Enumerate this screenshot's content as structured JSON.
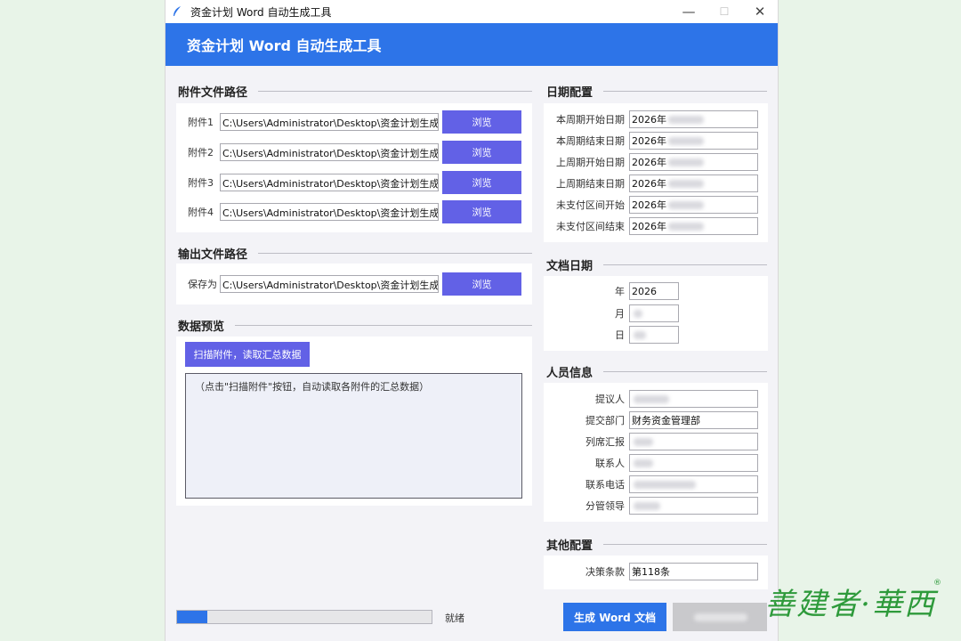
{
  "window": {
    "title": "资金计划 Word 自动生成工具",
    "header": "资金计划 Word 自动生成工具",
    "minimize": "—",
    "maximize": "☐",
    "close": "✕"
  },
  "attachments": {
    "title": "附件文件路径",
    "browse_label": "浏览",
    "items": [
      {
        "label": "附件1",
        "path": "C:\\Users\\Administrator\\Desktop\\资金计划生成"
      },
      {
        "label": "附件2",
        "path": "C:\\Users\\Administrator\\Desktop\\资金计划生成"
      },
      {
        "label": "附件3",
        "path": "C:\\Users\\Administrator\\Desktop\\资金计划生成"
      },
      {
        "label": "附件4",
        "path": "C:\\Users\\Administrator\\Desktop\\资金计划生成"
      }
    ]
  },
  "output": {
    "title": "输出文件路径",
    "save_label": "保存为",
    "path": "C:\\Users\\Administrator\\Desktop\\资金计划生成",
    "browse_label": "浏览"
  },
  "preview": {
    "title": "数据预览",
    "scan_button": "扫描附件，读取汇总数据",
    "hint": "（点击\"扫描附件\"按钮，自动读取各附件的汇总数据）"
  },
  "dates": {
    "title": "日期配置",
    "items": [
      {
        "label": "本周期开始日期",
        "value": "2026年"
      },
      {
        "label": "本周期结束日期",
        "value": "2026年"
      },
      {
        "label": "上周期开始日期",
        "value": "2026年"
      },
      {
        "label": "上周期结束日期",
        "value": "2026年"
      },
      {
        "label": "未支付区间开始",
        "value": "2026年"
      },
      {
        "label": "未支付区间结束",
        "value": "2026年"
      }
    ]
  },
  "doc_date": {
    "title": "文档日期",
    "year_label": "年",
    "year_value": "2026",
    "month_label": "月",
    "day_label": "日"
  },
  "people": {
    "title": "人员信息",
    "items": [
      {
        "label": "提议人",
        "value": ""
      },
      {
        "label": "提交部门",
        "value": "财务资金管理部"
      },
      {
        "label": "列席汇报",
        "value": ""
      },
      {
        "label": "联系人",
        "value": ""
      },
      {
        "label": "联系电话",
        "value": ""
      },
      {
        "label": "分管领导",
        "value": ""
      }
    ]
  },
  "other": {
    "title": "其他配置",
    "clause_label": "决策条款",
    "clause_value": "第118条"
  },
  "footer": {
    "progress": 0.12,
    "status": "就绪",
    "generate_button": "生成 Word 文档"
  },
  "watermark": {
    "text": "善建者·華西",
    "reg": "®"
  },
  "colors": {
    "accent": "#2d74e8",
    "button": "#6261e6"
  }
}
